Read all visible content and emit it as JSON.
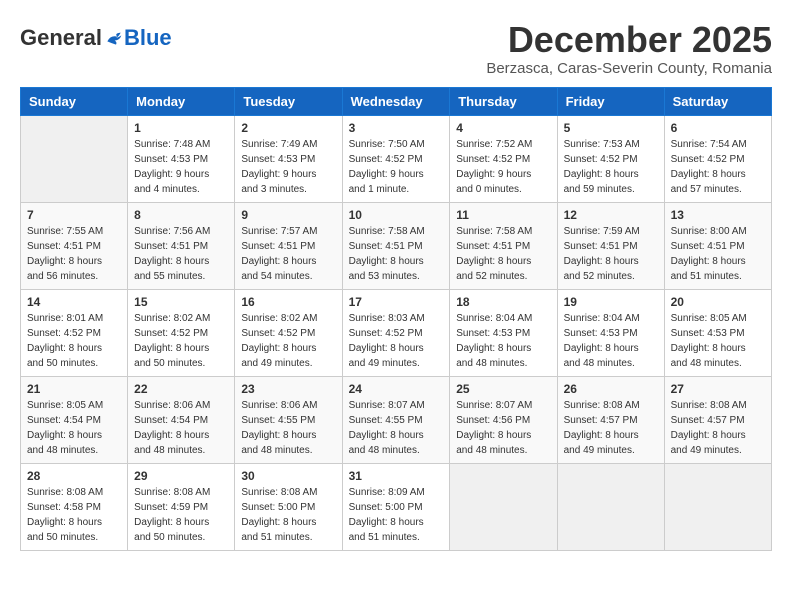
{
  "header": {
    "logo": {
      "general": "General",
      "blue": "Blue"
    },
    "title": "December 2025",
    "subtitle": "Berzasca, Caras-Severin County, Romania"
  },
  "calendar": {
    "days_of_week": [
      "Sunday",
      "Monday",
      "Tuesday",
      "Wednesday",
      "Thursday",
      "Friday",
      "Saturday"
    ],
    "weeks": [
      [
        {
          "day": "",
          "info": ""
        },
        {
          "day": "1",
          "info": "Sunrise: 7:48 AM\nSunset: 4:53 PM\nDaylight: 9 hours\nand 4 minutes."
        },
        {
          "day": "2",
          "info": "Sunrise: 7:49 AM\nSunset: 4:53 PM\nDaylight: 9 hours\nand 3 minutes."
        },
        {
          "day": "3",
          "info": "Sunrise: 7:50 AM\nSunset: 4:52 PM\nDaylight: 9 hours\nand 1 minute."
        },
        {
          "day": "4",
          "info": "Sunrise: 7:52 AM\nSunset: 4:52 PM\nDaylight: 9 hours\nand 0 minutes."
        },
        {
          "day": "5",
          "info": "Sunrise: 7:53 AM\nSunset: 4:52 PM\nDaylight: 8 hours\nand 59 minutes."
        },
        {
          "day": "6",
          "info": "Sunrise: 7:54 AM\nSunset: 4:52 PM\nDaylight: 8 hours\nand 57 minutes."
        }
      ],
      [
        {
          "day": "7",
          "info": "Sunrise: 7:55 AM\nSunset: 4:51 PM\nDaylight: 8 hours\nand 56 minutes."
        },
        {
          "day": "8",
          "info": "Sunrise: 7:56 AM\nSunset: 4:51 PM\nDaylight: 8 hours\nand 55 minutes."
        },
        {
          "day": "9",
          "info": "Sunrise: 7:57 AM\nSunset: 4:51 PM\nDaylight: 8 hours\nand 54 minutes."
        },
        {
          "day": "10",
          "info": "Sunrise: 7:58 AM\nSunset: 4:51 PM\nDaylight: 8 hours\nand 53 minutes."
        },
        {
          "day": "11",
          "info": "Sunrise: 7:58 AM\nSunset: 4:51 PM\nDaylight: 8 hours\nand 52 minutes."
        },
        {
          "day": "12",
          "info": "Sunrise: 7:59 AM\nSunset: 4:51 PM\nDaylight: 8 hours\nand 52 minutes."
        },
        {
          "day": "13",
          "info": "Sunrise: 8:00 AM\nSunset: 4:51 PM\nDaylight: 8 hours\nand 51 minutes."
        }
      ],
      [
        {
          "day": "14",
          "info": "Sunrise: 8:01 AM\nSunset: 4:52 PM\nDaylight: 8 hours\nand 50 minutes."
        },
        {
          "day": "15",
          "info": "Sunrise: 8:02 AM\nSunset: 4:52 PM\nDaylight: 8 hours\nand 50 minutes."
        },
        {
          "day": "16",
          "info": "Sunrise: 8:02 AM\nSunset: 4:52 PM\nDaylight: 8 hours\nand 49 minutes."
        },
        {
          "day": "17",
          "info": "Sunrise: 8:03 AM\nSunset: 4:52 PM\nDaylight: 8 hours\nand 49 minutes."
        },
        {
          "day": "18",
          "info": "Sunrise: 8:04 AM\nSunset: 4:53 PM\nDaylight: 8 hours\nand 48 minutes."
        },
        {
          "day": "19",
          "info": "Sunrise: 8:04 AM\nSunset: 4:53 PM\nDaylight: 8 hours\nand 48 minutes."
        },
        {
          "day": "20",
          "info": "Sunrise: 8:05 AM\nSunset: 4:53 PM\nDaylight: 8 hours\nand 48 minutes."
        }
      ],
      [
        {
          "day": "21",
          "info": "Sunrise: 8:05 AM\nSunset: 4:54 PM\nDaylight: 8 hours\nand 48 minutes."
        },
        {
          "day": "22",
          "info": "Sunrise: 8:06 AM\nSunset: 4:54 PM\nDaylight: 8 hours\nand 48 minutes."
        },
        {
          "day": "23",
          "info": "Sunrise: 8:06 AM\nSunset: 4:55 PM\nDaylight: 8 hours\nand 48 minutes."
        },
        {
          "day": "24",
          "info": "Sunrise: 8:07 AM\nSunset: 4:55 PM\nDaylight: 8 hours\nand 48 minutes."
        },
        {
          "day": "25",
          "info": "Sunrise: 8:07 AM\nSunset: 4:56 PM\nDaylight: 8 hours\nand 48 minutes."
        },
        {
          "day": "26",
          "info": "Sunrise: 8:08 AM\nSunset: 4:57 PM\nDaylight: 8 hours\nand 49 minutes."
        },
        {
          "day": "27",
          "info": "Sunrise: 8:08 AM\nSunset: 4:57 PM\nDaylight: 8 hours\nand 49 minutes."
        }
      ],
      [
        {
          "day": "28",
          "info": "Sunrise: 8:08 AM\nSunset: 4:58 PM\nDaylight: 8 hours\nand 50 minutes."
        },
        {
          "day": "29",
          "info": "Sunrise: 8:08 AM\nSunset: 4:59 PM\nDaylight: 8 hours\nand 50 minutes."
        },
        {
          "day": "30",
          "info": "Sunrise: 8:08 AM\nSunset: 5:00 PM\nDaylight: 8 hours\nand 51 minutes."
        },
        {
          "day": "31",
          "info": "Sunrise: 8:09 AM\nSunset: 5:00 PM\nDaylight: 8 hours\nand 51 minutes."
        },
        {
          "day": "",
          "info": ""
        },
        {
          "day": "",
          "info": ""
        },
        {
          "day": "",
          "info": ""
        }
      ]
    ]
  }
}
